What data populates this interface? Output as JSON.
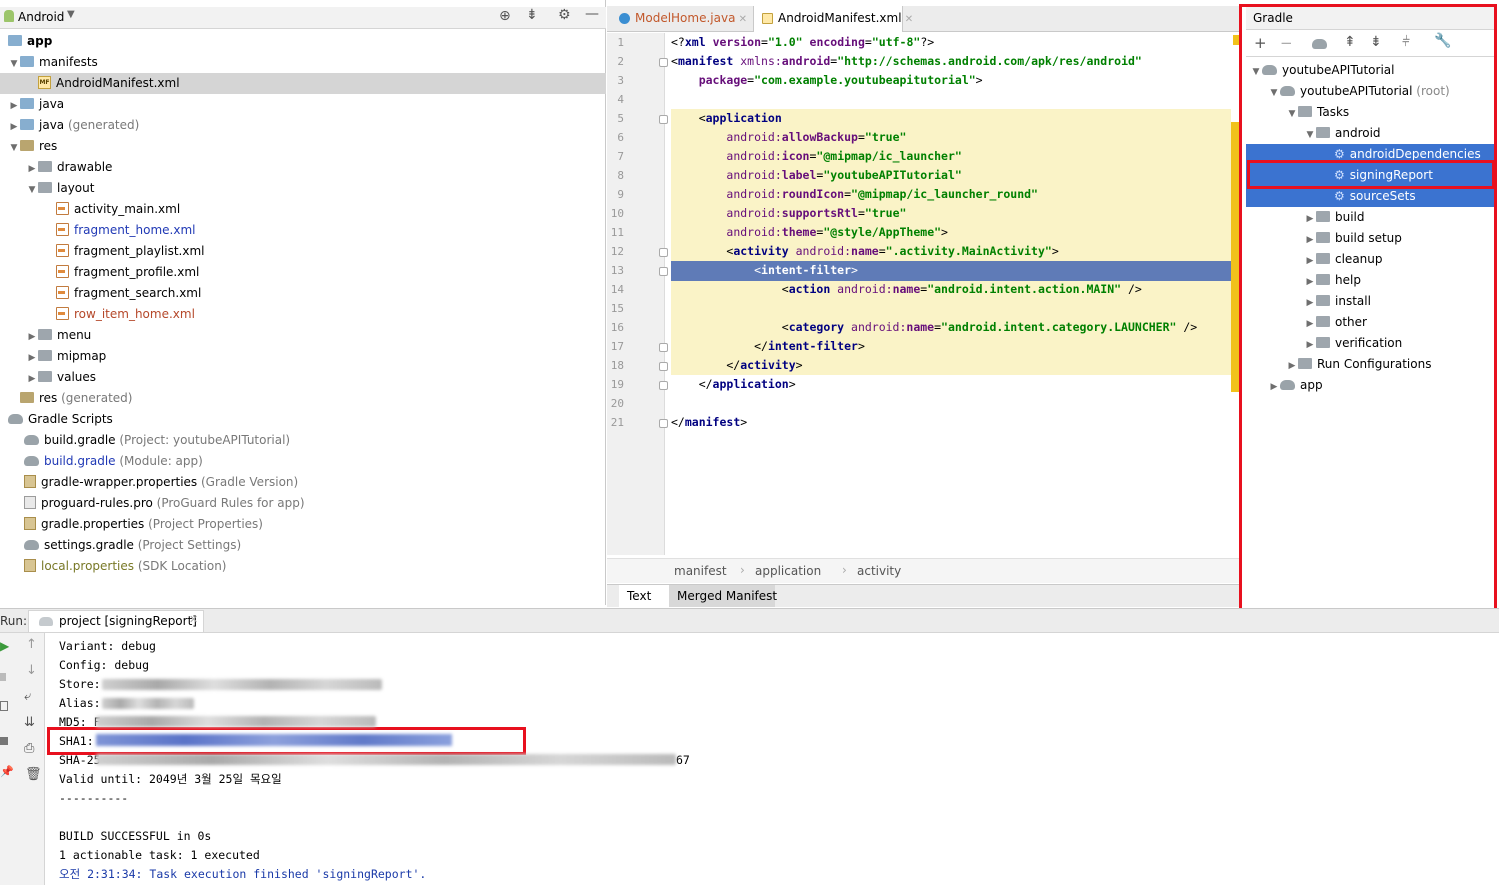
{
  "project_panel": {
    "view_label": "Android",
    "tree": [
      {
        "label": "app",
        "hint": "",
        "kind": "app",
        "depth": 0,
        "chevron": "",
        "bold": true
      },
      {
        "label": "manifests",
        "hint": "",
        "kind": "folder",
        "depth": 1,
        "chevron": "down"
      },
      {
        "label": "AndroidManifest.xml",
        "hint": "",
        "kind": "manifest",
        "depth": 2,
        "chevron": "",
        "selected": true
      },
      {
        "label": "java",
        "hint": "",
        "kind": "folder",
        "depth": 1,
        "chevron": "right"
      },
      {
        "label": "java",
        "hint": "(generated)",
        "kind": "folder",
        "depth": 1,
        "chevron": "right"
      },
      {
        "label": "res",
        "hint": "",
        "kind": "folder-res",
        "depth": 1,
        "chevron": "down"
      },
      {
        "label": "drawable",
        "hint": "",
        "kind": "folder-gray",
        "depth": 2,
        "chevron": "right"
      },
      {
        "label": "layout",
        "hint": "",
        "kind": "folder-gray",
        "depth": 2,
        "chevron": "down"
      },
      {
        "label": "activity_main.xml",
        "hint": "",
        "kind": "xml",
        "depth": 3,
        "chevron": ""
      },
      {
        "label": "fragment_home.xml",
        "hint": "",
        "kind": "xml",
        "depth": 3,
        "chevron": "",
        "color": "#2039b5"
      },
      {
        "label": "fragment_playlist.xml",
        "hint": "",
        "kind": "xml",
        "depth": 3,
        "chevron": ""
      },
      {
        "label": "fragment_profile.xml",
        "hint": "",
        "kind": "xml",
        "depth": 3,
        "chevron": ""
      },
      {
        "label": "fragment_search.xml",
        "hint": "",
        "kind": "xml",
        "depth": 3,
        "chevron": ""
      },
      {
        "label": "row_item_home.xml",
        "hint": "",
        "kind": "xml",
        "depth": 3,
        "chevron": "",
        "color": "#b5482a"
      },
      {
        "label": "menu",
        "hint": "",
        "kind": "folder-gray",
        "depth": 2,
        "chevron": "right"
      },
      {
        "label": "mipmap",
        "hint": "",
        "kind": "folder-gray",
        "depth": 2,
        "chevron": "right"
      },
      {
        "label": "values",
        "hint": "",
        "kind": "folder-gray",
        "depth": 2,
        "chevron": "right"
      },
      {
        "label": "res",
        "hint": "(generated)",
        "kind": "folder-res",
        "depth": 1,
        "chevron": ""
      },
      {
        "label": "Gradle Scripts",
        "hint": "",
        "kind": "gradle",
        "depth": 0,
        "chevron": ""
      },
      {
        "label": "build.gradle",
        "hint": "(Project: youtubeAPITutorial)",
        "kind": "gradle",
        "depth": 1,
        "chevron": ""
      },
      {
        "label": "build.gradle",
        "hint": "(Module: app)",
        "kind": "gradle",
        "depth": 1,
        "chevron": "",
        "color": "#2039b5"
      },
      {
        "label": "gradle-wrapper.properties",
        "hint": "(Gradle Version)",
        "kind": "prop",
        "depth": 1,
        "chevron": ""
      },
      {
        "label": "proguard-rules.pro",
        "hint": "(ProGuard Rules for app)",
        "kind": "file",
        "depth": 1,
        "chevron": ""
      },
      {
        "label": "gradle.properties",
        "hint": "(Project Properties)",
        "kind": "prop",
        "depth": 1,
        "chevron": ""
      },
      {
        "label": "settings.gradle",
        "hint": "(Project Settings)",
        "kind": "gradle",
        "depth": 1,
        "chevron": ""
      },
      {
        "label": "local.properties",
        "hint": "(SDK Location)",
        "kind": "prop",
        "depth": 1,
        "chevron": "",
        "color": "#787826"
      }
    ]
  },
  "editor": {
    "tabs": [
      {
        "label": "ModelHome.java",
        "active": false,
        "color": "#c2582b"
      },
      {
        "label": "AndroidManifest.xml",
        "active": true,
        "color": "#000000"
      }
    ],
    "lines": [
      {
        "n": "1",
        "segs": [
          [
            "p",
            "<?"
          ],
          [
            "tg",
            "xml "
          ],
          [
            "at",
            "version"
          ],
          [
            "p",
            "="
          ],
          [
            "st",
            "\"1.0\" "
          ],
          [
            "at",
            "encoding"
          ],
          [
            "p",
            "="
          ],
          [
            "st",
            "\"utf-8\""
          ],
          [
            "p",
            "?>"
          ]
        ]
      },
      {
        "n": "2",
        "segs": [
          [
            "p",
            "<"
          ],
          [
            "tg",
            "manifest "
          ],
          [
            "ns",
            "xmlns:"
          ],
          [
            "at",
            "android"
          ],
          [
            "p",
            "="
          ],
          [
            "st",
            "\"http://schemas.android.com/apk/res/android\""
          ]
        ]
      },
      {
        "n": "3",
        "segs": [
          [
            "p",
            "    "
          ],
          [
            "at",
            "package"
          ],
          [
            "p",
            "="
          ],
          [
            "st",
            "\"com.example.youtubeapitutorial\""
          ],
          [
            "p",
            ">"
          ]
        ]
      },
      {
        "n": "4",
        "segs": []
      },
      {
        "n": "5",
        "segs": [
          [
            "p",
            "    <"
          ],
          [
            "tg",
            "application"
          ]
        ]
      },
      {
        "n": "6",
        "segs": [
          [
            "p",
            "        "
          ],
          [
            "ns",
            "android:"
          ],
          [
            "at",
            "allowBackup"
          ],
          [
            "p",
            "="
          ],
          [
            "st",
            "\"true\""
          ]
        ]
      },
      {
        "n": "7",
        "segs": [
          [
            "p",
            "        "
          ],
          [
            "ns",
            "android:"
          ],
          [
            "at",
            "icon"
          ],
          [
            "p",
            "="
          ],
          [
            "st",
            "\"@mipmap/ic_launcher\""
          ]
        ]
      },
      {
        "n": "8",
        "segs": [
          [
            "p",
            "        "
          ],
          [
            "ns",
            "android:"
          ],
          [
            "at",
            "label"
          ],
          [
            "p",
            "="
          ],
          [
            "st",
            "\"youtubeAPITutorial\""
          ]
        ]
      },
      {
        "n": "9",
        "segs": [
          [
            "p",
            "        "
          ],
          [
            "ns",
            "android:"
          ],
          [
            "at",
            "roundIcon"
          ],
          [
            "p",
            "="
          ],
          [
            "st",
            "\"@mipmap/ic_launcher_round\""
          ]
        ]
      },
      {
        "n": "10",
        "segs": [
          [
            "p",
            "        "
          ],
          [
            "ns",
            "android:"
          ],
          [
            "at",
            "supportsRtl"
          ],
          [
            "p",
            "="
          ],
          [
            "st",
            "\"true\""
          ]
        ]
      },
      {
        "n": "11",
        "segs": [
          [
            "p",
            "        "
          ],
          [
            "ns",
            "android:"
          ],
          [
            "at",
            "theme"
          ],
          [
            "p",
            "="
          ],
          [
            "st",
            "\"@style/AppTheme\""
          ],
          [
            "p",
            ">"
          ]
        ]
      },
      {
        "n": "12",
        "segs": [
          [
            "p",
            "        <"
          ],
          [
            "tg",
            "activity "
          ],
          [
            "ns",
            "android:"
          ],
          [
            "at",
            "name"
          ],
          [
            "p",
            "="
          ],
          [
            "st",
            "\".activity.MainActivity\""
          ],
          [
            "p",
            ">"
          ]
        ]
      },
      {
        "n": "13",
        "segs": [
          [
            "p",
            "            <"
          ],
          [
            "tg",
            "intent-filter"
          ],
          [
            "p",
            ">"
          ]
        ]
      },
      {
        "n": "14",
        "segs": [
          [
            "p",
            "                <"
          ],
          [
            "tg",
            "action "
          ],
          [
            "ns",
            "android:"
          ],
          [
            "at",
            "name"
          ],
          [
            "p",
            "="
          ],
          [
            "st",
            "\"android.intent.action.MAIN\" "
          ],
          [
            "p",
            "/>"
          ]
        ]
      },
      {
        "n": "15",
        "segs": []
      },
      {
        "n": "16",
        "segs": [
          [
            "p",
            "                <"
          ],
          [
            "tg",
            "category "
          ],
          [
            "ns",
            "android:"
          ],
          [
            "at",
            "name"
          ],
          [
            "p",
            "="
          ],
          [
            "st",
            "\"android.intent.category.LAUNCHER\" "
          ],
          [
            "p",
            "/>"
          ]
        ]
      },
      {
        "n": "17",
        "segs": [
          [
            "p",
            "            </"
          ],
          [
            "tg",
            "intent-filter"
          ],
          [
            "p",
            ">"
          ]
        ]
      },
      {
        "n": "18",
        "segs": [
          [
            "p",
            "        </"
          ],
          [
            "tg",
            "activity"
          ],
          [
            "p",
            ">"
          ]
        ]
      },
      {
        "n": "19",
        "segs": [
          [
            "p",
            "    </"
          ],
          [
            "tg",
            "application"
          ],
          [
            "p",
            ">"
          ]
        ]
      },
      {
        "n": "20",
        "segs": []
      },
      {
        "n": "21",
        "segs": [
          [
            "p",
            "</"
          ],
          [
            "tg",
            "manifest"
          ],
          [
            "p",
            ">"
          ]
        ]
      }
    ],
    "breadcrumb": [
      "manifest",
      "application",
      "activity"
    ],
    "bottom_tabs": [
      "Text",
      "Merged Manifest"
    ]
  },
  "gradle": {
    "title": "Gradle",
    "tree": [
      {
        "label": "youtubeAPITutorial",
        "hint": "",
        "depth": 0,
        "chevron": "down",
        "kind": "gradle"
      },
      {
        "label": "youtubeAPITutorial",
        "hint": "(root)",
        "depth": 1,
        "chevron": "down",
        "kind": "gradle"
      },
      {
        "label": "Tasks",
        "hint": "",
        "depth": 2,
        "chevron": "down",
        "kind": "folder"
      },
      {
        "label": "android",
        "hint": "",
        "depth": 3,
        "chevron": "down",
        "kind": "folder"
      },
      {
        "label": "androidDependencies",
        "hint": "",
        "depth": 4,
        "chevron": "",
        "kind": "task",
        "selected": true
      },
      {
        "label": "signingReport",
        "hint": "",
        "depth": 4,
        "chevron": "",
        "kind": "task",
        "selected": true
      },
      {
        "label": "sourceSets",
        "hint": "",
        "depth": 4,
        "chevron": "",
        "kind": "task",
        "selected": true
      },
      {
        "label": "build",
        "hint": "",
        "depth": 3,
        "chevron": "right",
        "kind": "folder"
      },
      {
        "label": "build setup",
        "hint": "",
        "depth": 3,
        "chevron": "right",
        "kind": "folder"
      },
      {
        "label": "cleanup",
        "hint": "",
        "depth": 3,
        "chevron": "right",
        "kind": "folder"
      },
      {
        "label": "help",
        "hint": "",
        "depth": 3,
        "chevron": "right",
        "kind": "folder"
      },
      {
        "label": "install",
        "hint": "",
        "depth": 3,
        "chevron": "right",
        "kind": "folder"
      },
      {
        "label": "other",
        "hint": "",
        "depth": 3,
        "chevron": "right",
        "kind": "folder"
      },
      {
        "label": "verification",
        "hint": "",
        "depth": 3,
        "chevron": "right",
        "kind": "folder"
      },
      {
        "label": "Run Configurations",
        "hint": "",
        "depth": 2,
        "chevron": "right",
        "kind": "folder"
      },
      {
        "label": "app",
        "hint": "",
        "depth": 1,
        "chevron": "right",
        "kind": "gradle"
      }
    ]
  },
  "run": {
    "label": "Run:",
    "tab_label": "project [signingReport]",
    "lines": [
      {
        "text": "Variant: debug",
        "color": "#000"
      },
      {
        "text": "Config: debug",
        "color": "#000"
      },
      {
        "text": "Store: ",
        "color": "#000"
      },
      {
        "text": "Alias: ",
        "color": "#000"
      },
      {
        "text": "MD5: F",
        "color": "#000"
      },
      {
        "text": "SHA1: ",
        "color": "#000"
      },
      {
        "text": "SHA-25",
        "color": "#000",
        "tail": "67"
      },
      {
        "text": "Valid until: 2049년 3월 25일 목요일",
        "color": "#000"
      },
      {
        "text": "----------",
        "color": "#000"
      },
      {
        "text": "",
        "color": "#000"
      },
      {
        "text": "BUILD SUCCESSFUL in 0s",
        "color": "#000"
      },
      {
        "text": "1 actionable task: 1 executed",
        "color": "#000"
      },
      {
        "text": "오전 2:31:34: Task execution finished 'signingReport'.",
        "color": "#1a3aa8"
      }
    ]
  },
  "colors": {
    "selection": "#3b73d0",
    "highlight_bg": "#faf3c7",
    "caret_line": "#5f7bb7",
    "annotation_red": "#e8101e"
  }
}
